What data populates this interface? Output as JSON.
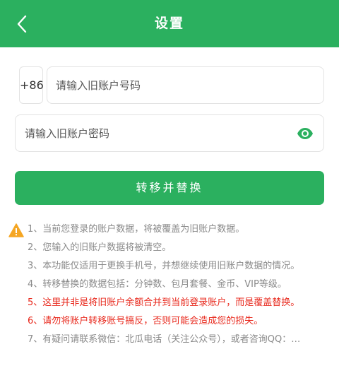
{
  "header": {
    "title": "设置"
  },
  "form": {
    "country_code": "+86",
    "account_placeholder": "请输入旧账户号码",
    "password_placeholder": "请输入旧账户密码",
    "submit_label": "转移并替换"
  },
  "notes": [
    {
      "text": "1、当前您登录的账户数据，将被覆盖为旧账户数据。",
      "highlight": false
    },
    {
      "text": "2、您输入的旧账户数据将被清空。",
      "highlight": false
    },
    {
      "text": "3、本功能仅适用于更换手机号，并想继续使用旧账户数据的情况。",
      "highlight": false
    },
    {
      "text": "4、转移替换的数据包括：分钟数、包月套餐、金币、VIP等级。",
      "highlight": false
    },
    {
      "text": "5、这里并非是将旧账户余额合并到当前登录账户，而是覆盖替换。",
      "highlight": true
    },
    {
      "text": "6、请勿将账户转移账号搞反，否则可能会造成您的损失。",
      "highlight": true
    },
    {
      "text": "7、有疑问请联系微信：北瓜电话（关注公众号），或者咨询QQ：…",
      "highlight": false
    }
  ],
  "colors": {
    "primary": "#2bb05f",
    "warning": "#f5a623",
    "alert": "#e8281c"
  }
}
